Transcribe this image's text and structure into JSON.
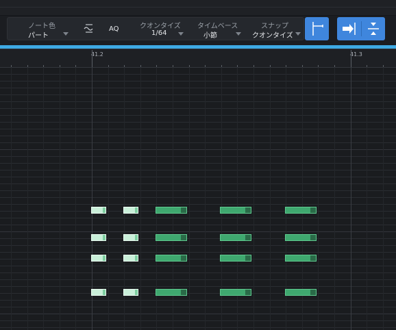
{
  "toolbar": {
    "note_color": {
      "label": "ノート色",
      "value": "パート"
    },
    "aq_label": "AQ",
    "quantize": {
      "label": "クオンタイズ",
      "value": "1/64"
    },
    "timebase": {
      "label": "タイムベース",
      "value": "小節"
    },
    "snap": {
      "label": "スナップ",
      "value": "クオンタイズ"
    }
  },
  "ruler": {
    "markers": [
      "41.2",
      "41.3"
    ]
  },
  "colors": {
    "accent": "#3ea9e3",
    "button_blue": "#3f86dd",
    "note_fill": "#3fa86f",
    "note_short_fill": "#c9efd9"
  },
  "icons": [
    "quantize-wave-icon",
    "snap-start-icon",
    "arrow-right-to-line-icon",
    "split-icon"
  ]
}
